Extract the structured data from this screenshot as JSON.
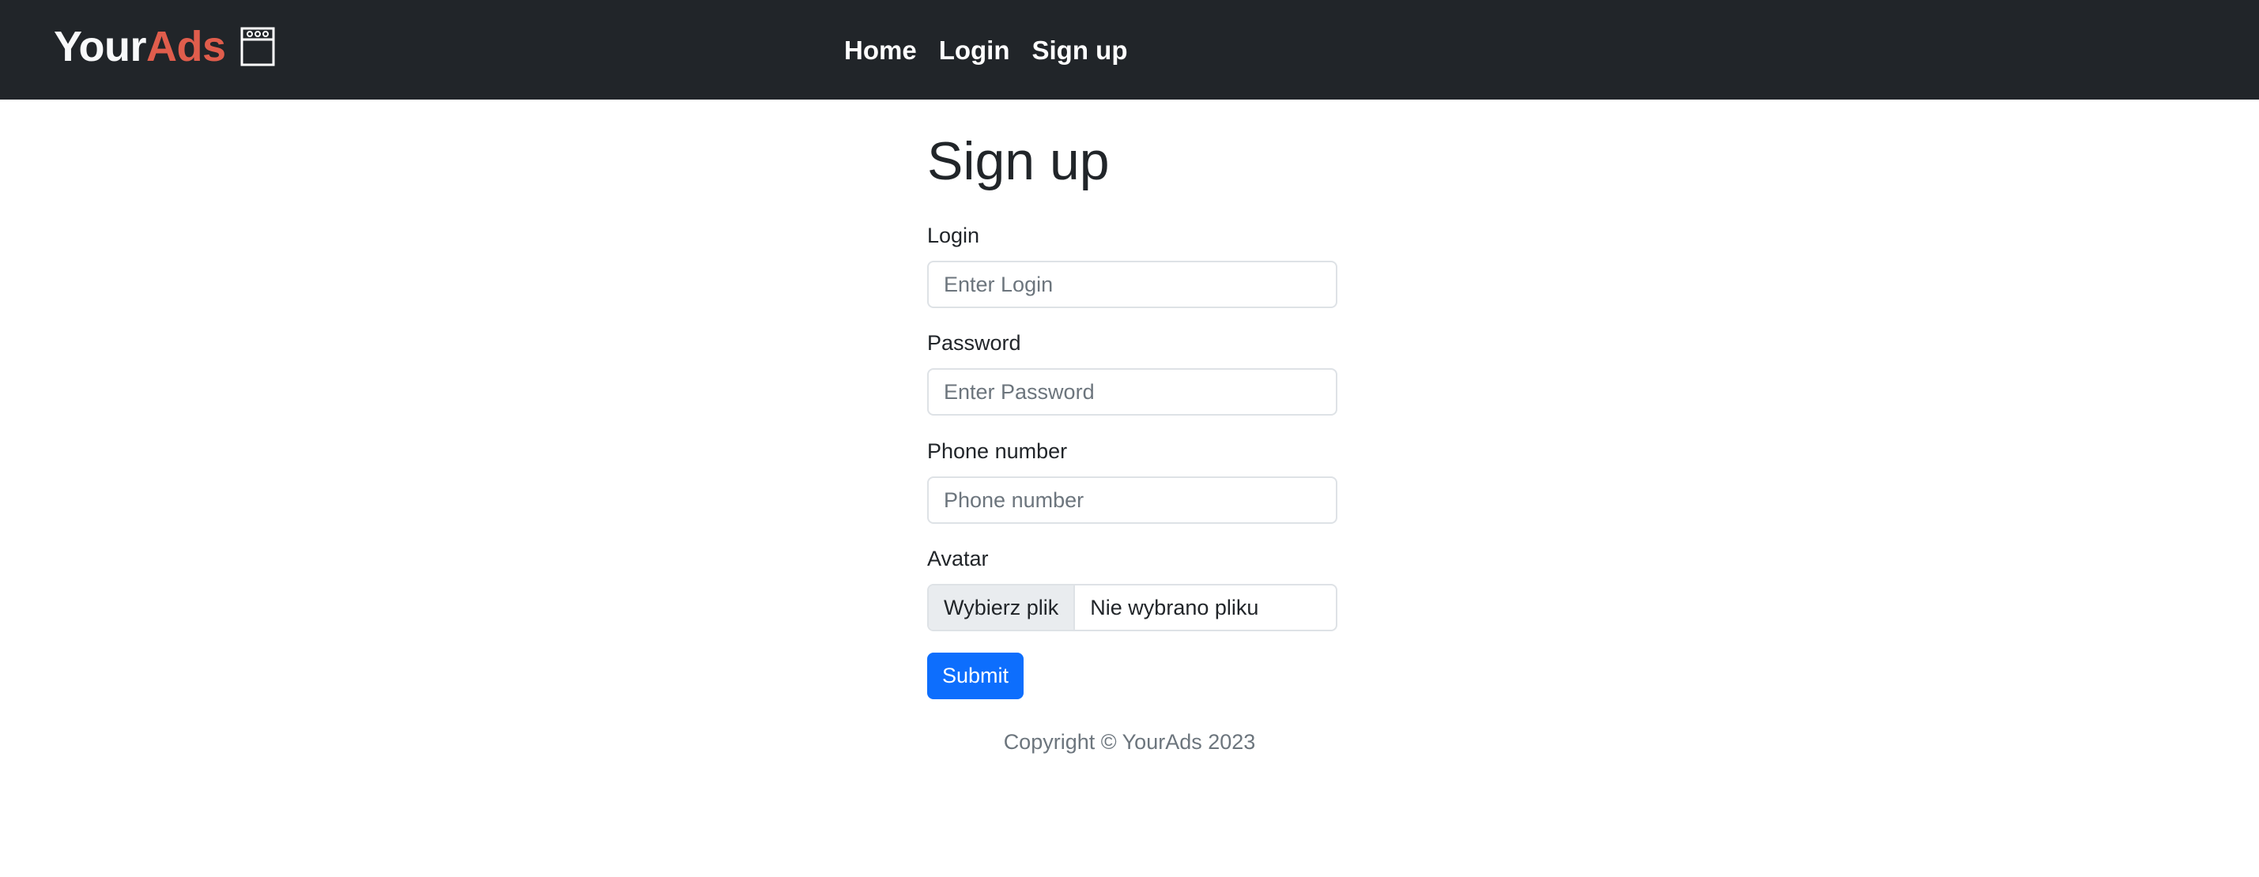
{
  "brand": {
    "part1": "Your",
    "part2": "Ads",
    "icon": "billboard-icon",
    "accent_color": "#e05d4c"
  },
  "nav": {
    "items": [
      {
        "label": "Home"
      },
      {
        "label": "Login"
      },
      {
        "label": "Sign up"
      }
    ]
  },
  "page": {
    "title": "Sign up"
  },
  "form": {
    "login": {
      "label": "Login",
      "placeholder": "Enter Login",
      "value": ""
    },
    "password": {
      "label": "Password",
      "placeholder": "Enter Password",
      "value": ""
    },
    "phone": {
      "label": "Phone number",
      "placeholder": "Phone number",
      "value": ""
    },
    "avatar": {
      "label": "Avatar",
      "button": "Wybierz plik",
      "status": "Nie wybrano pliku"
    },
    "submit_label": "Submit"
  },
  "footer": {
    "text": "Copyright © YourAds 2023"
  },
  "colors": {
    "navbar_bg": "#212529",
    "primary": "#0d6efd"
  }
}
